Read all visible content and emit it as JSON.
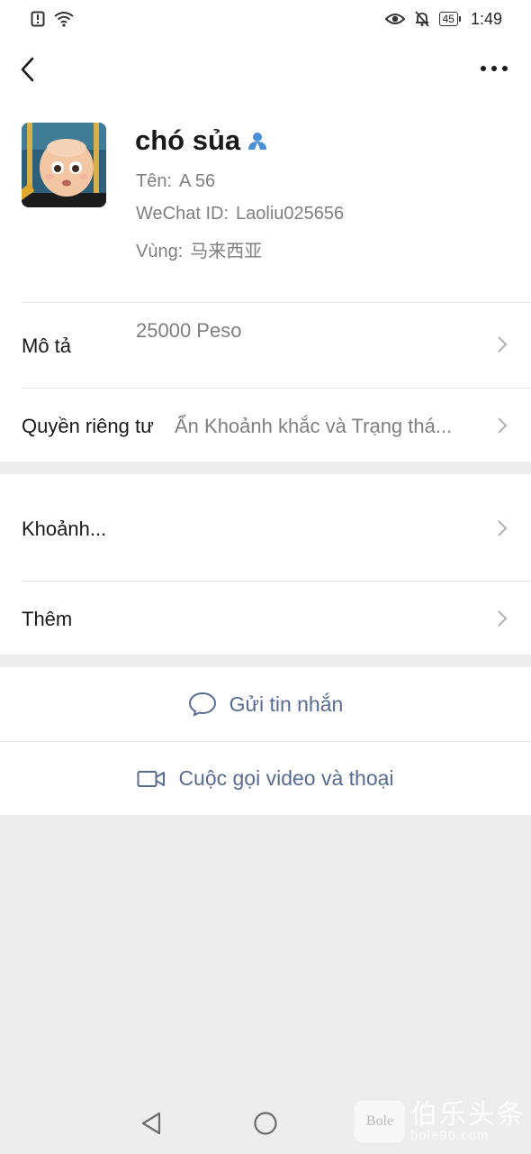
{
  "status_bar": {
    "battery": "45",
    "time": "1:49",
    "icons": [
      "alert-icon",
      "wifi-icon",
      "eye-icon",
      "mute-bell-icon",
      "battery-icon"
    ]
  },
  "header": {
    "back_icon": "chevron-left-icon",
    "more_icon": "more-dots-icon"
  },
  "profile": {
    "nickname": "chó sủa",
    "badge_icon": "contact-person-icon",
    "name_label": "Tên:",
    "name_value": "A 56",
    "wechat_label": "WeChat ID:",
    "wechat_value": "Laoliu025656",
    "region_label": "Vùng:",
    "region_value": "马来西亚"
  },
  "rows": {
    "description_label": "Mô tả",
    "description_value": "25000 Peso",
    "privacy_label": "Quyền riêng tư",
    "privacy_value": "Ẩn Khoảnh khắc và Trạng thá...",
    "moments_label": "Khoảnh...",
    "more_label": "Thêm"
  },
  "actions": {
    "message_label": "Gửi tin nhắn",
    "call_label": "Cuộc gọi video và thoại"
  },
  "watermark": {
    "chinese": "伯乐头条",
    "domain": "bole90.com"
  },
  "colors": {
    "accent": "#576b95",
    "badge": "#4a90d9",
    "background": "#ededed"
  }
}
